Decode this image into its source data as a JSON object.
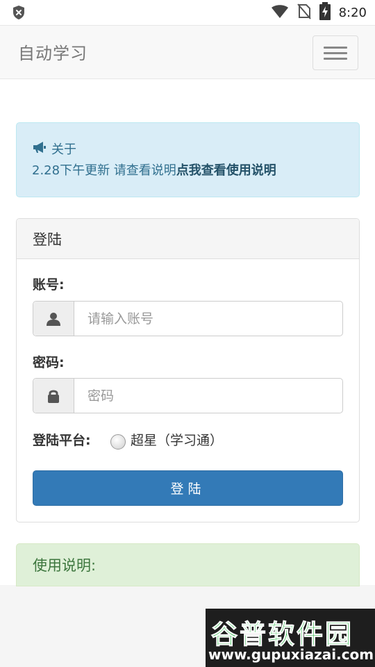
{
  "status_bar": {
    "time": "8:20",
    "icons": [
      "shield-x-icon",
      "wifi-icon",
      "no-sim-icon",
      "battery-charging-icon"
    ]
  },
  "navbar": {
    "brand": "自动学习",
    "toggle_icon": "hamburger-menu-icon"
  },
  "announcement": {
    "icon": "bullhorn-icon",
    "title": "关于",
    "text": "2.28下午更新 请查看说明",
    "link_text": "点我查看使用说明"
  },
  "login_panel": {
    "title": "登陆",
    "account_label": "账号:",
    "account_placeholder": "请输入账号",
    "account_icon": "user-icon",
    "password_label": "密码:",
    "password_placeholder": "密码",
    "password_icon": "lock-icon",
    "platform_label": "登陆平台:",
    "platform_option": "超星（学习通）",
    "submit_label": "登陆"
  },
  "usage": {
    "title": "使用说明:"
  },
  "watermark": {
    "title": "谷普软件园",
    "url": "www.gupuxiazai.com"
  },
  "colors": {
    "primary": "#337ab7",
    "info_bg": "#d9edf7",
    "info_text": "#31708f",
    "success_bg": "#dff0d8",
    "success_text": "#3c763d"
  }
}
